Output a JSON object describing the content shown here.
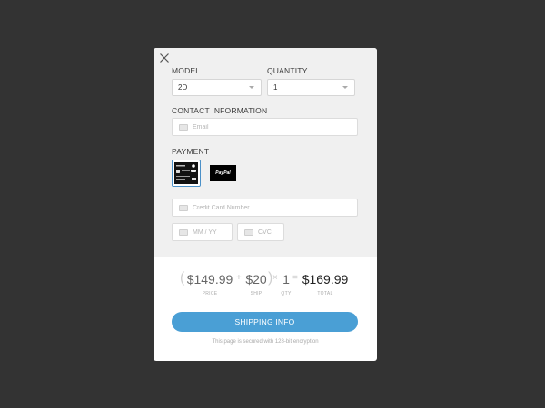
{
  "form": {
    "model_label": "MODEL",
    "model_value": "2D",
    "quantity_label": "QUANTITY",
    "quantity_value": "1",
    "contact_label": "CONTACT INFORMATION",
    "email_placeholder": "Email",
    "payment_label": "PAYMENT",
    "paypal_text": "PayPal",
    "card_number_placeholder": "Credit Card Number",
    "expiry_placeholder": "MM / YY",
    "cvc_placeholder": "CVC"
  },
  "summary": {
    "price": "$149.99",
    "price_caption": "PRICE",
    "ship": "$20",
    "ship_caption": "SHIP",
    "qty": "1",
    "qty_caption": "QTY",
    "total": "$169.99",
    "total_caption": "TOTAL",
    "plus": "+",
    "times": "×",
    "equals": "=",
    "open_paren": "(",
    "close_paren": ")"
  },
  "actions": {
    "shipping_button": "SHIPPING INFO"
  },
  "footer": {
    "secure_text": "This page is secured with 128-bit encryption"
  },
  "colors": {
    "backdrop": "#333333",
    "accent": "#4a9fd5",
    "panel": "#f0f0f0"
  },
  "icons": [
    "close-icon",
    "card-icon",
    "calendar-icon",
    "lock-icon",
    "chevron-down-icon"
  ]
}
